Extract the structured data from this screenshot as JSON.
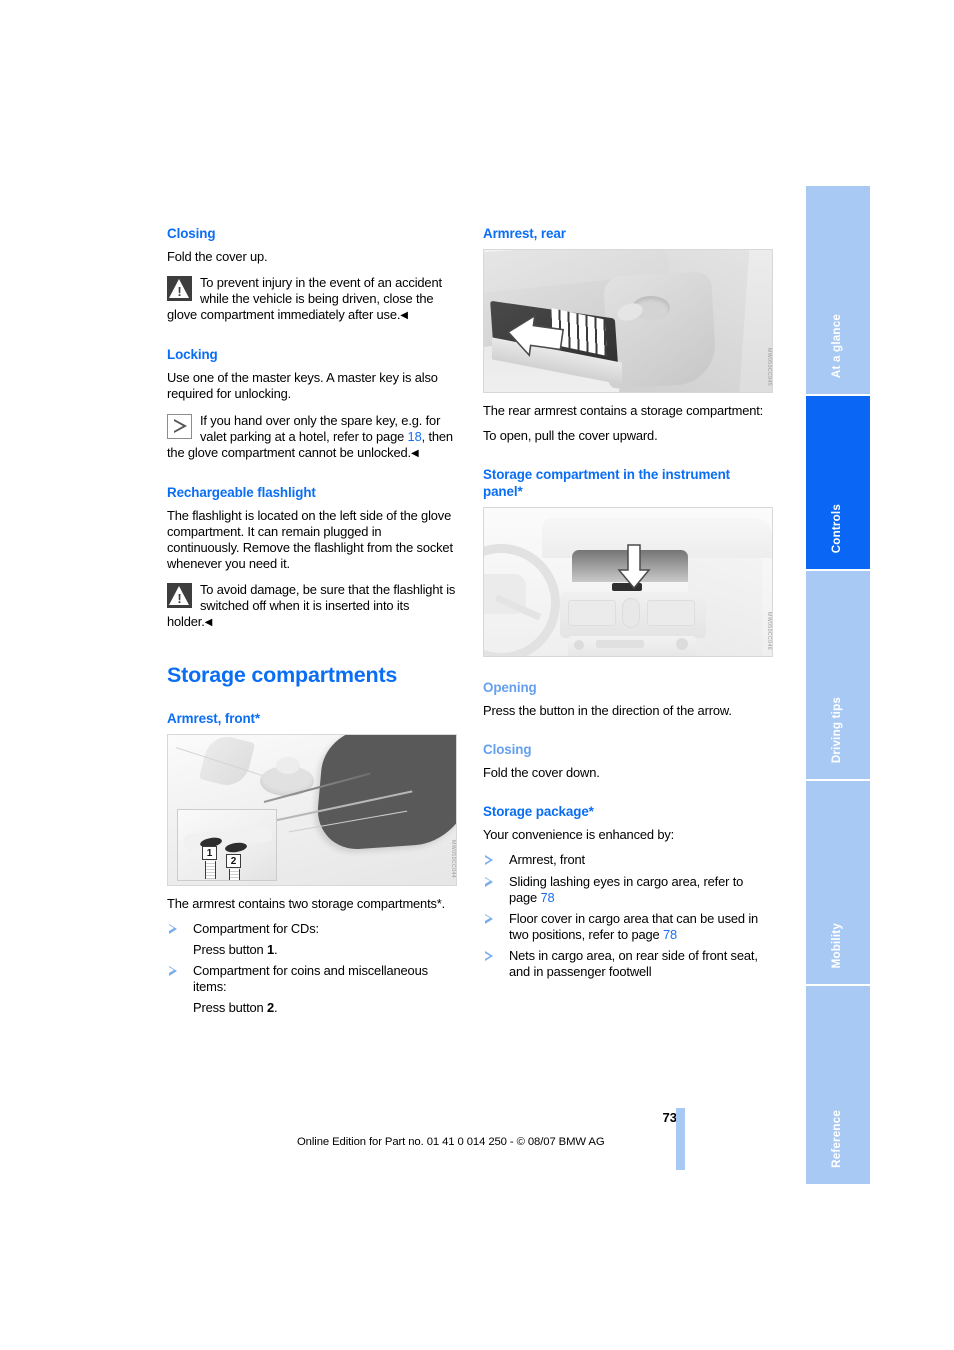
{
  "page": {
    "number": "73",
    "footer_line": "Online Edition for Part no. 01 41 0 014 250 - © 08/07 BMW AG"
  },
  "colors": {
    "heading_blue": "#0a6ef5",
    "light_blue": "#64a0ef",
    "tab_blue": "#a8c9f4",
    "tab_active_blue": "#0a66f5",
    "link_blue": "#1a6ff0"
  },
  "left_column": {
    "closing": {
      "heading": "Closing",
      "body": "Fold the cover up.",
      "warning": "To prevent injury in the event of an accident while the vehicle is being driven, close the glove compartment immediately after use.",
      "end_mark": "◀"
    },
    "locking": {
      "heading": "Locking",
      "body": "Use one of the master keys. A master key is also required for unlocking.",
      "note_part1": "If you hand over only the spare key, e.g. for valet parking at a hotel, refer to page ",
      "note_page_ref": "18",
      "note_part2": ", then the glove compartment cannot be unlocked.",
      "end_mark": "◀"
    },
    "flashlight": {
      "heading": "Rechargeable flashlight",
      "body": "The flashlight is located on the left side of the glove compartment. It can remain plugged in continuously. Remove the flashlight from the socket whenever you need it.",
      "warning": "To avoid damage, be sure that the flashlight is switched off when it is inserted into its holder.",
      "end_mark": "◀"
    },
    "storage_compartments": {
      "title": "Storage compartments",
      "armrest_front": {
        "heading": "Armrest, front*",
        "figure_code": "MW050CC044",
        "figure_button_1": "1",
        "figure_button_2": "2",
        "body": "The armrest contains two storage compartments*.",
        "bullets": [
          {
            "text": "Compartment for CDs:",
            "sub": "Press button 1.",
            "sub_prefix": "Press button ",
            "sub_bold": "1",
            "sub_suffix": "."
          },
          {
            "text": "Compartment for coins and miscellaneous items:",
            "sub": "Press button 2.",
            "sub_prefix": "Press button ",
            "sub_bold": "2",
            "sub_suffix": "."
          }
        ]
      }
    }
  },
  "right_column": {
    "armrest_rear": {
      "heading": "Armrest, rear",
      "figure_code": "MW050CC045",
      "body1": "The rear armrest contains a storage compartment:",
      "body2": "To open, pull the cover upward."
    },
    "storage_instrument_panel": {
      "heading": "Storage compartment in the instrument panel*",
      "figure_code": "MW050CC046",
      "opening": {
        "heading": "Opening",
        "body": "Press the button in the direction of the arrow."
      },
      "closing": {
        "heading": "Closing",
        "body": "Fold the cover down."
      }
    },
    "storage_package": {
      "heading": "Storage package*",
      "intro": "Your convenience is enhanced by:",
      "bullets": [
        {
          "text": "Armrest, front"
        },
        {
          "text_prefix": "Sliding lashing eyes in cargo area, refer to page ",
          "page_ref": "78",
          "text_suffix": ""
        },
        {
          "text_prefix": "Floor cover in cargo area that can be used in two positions, refer to page ",
          "page_ref": "78",
          "text_suffix": ""
        },
        {
          "text": "Nets in cargo area, on rear side of front seat, and in passenger footwell"
        }
      ]
    }
  },
  "tabs": [
    {
      "label": "At a glance",
      "active": false
    },
    {
      "label": "Controls",
      "active": true
    },
    {
      "label": "Driving tips",
      "active": false
    },
    {
      "label": "Mobility",
      "active": false
    },
    {
      "label": "Reference",
      "active": false
    }
  ]
}
